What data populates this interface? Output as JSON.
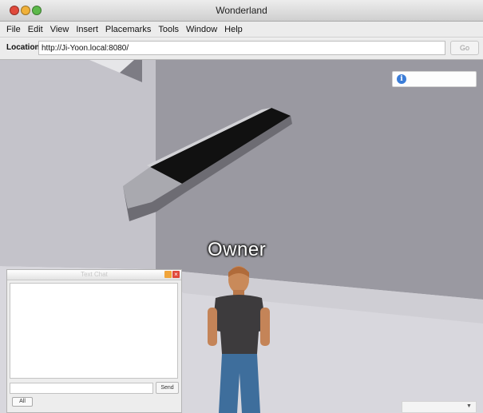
{
  "window": {
    "title": "Wonderland"
  },
  "menu": [
    "File",
    "Edit",
    "View",
    "Insert",
    "Placemarks",
    "Tools",
    "Window",
    "Help"
  ],
  "location": {
    "label": "Location:",
    "url": "http://Ji-Yoon.local:8080/",
    "go_label": "Go"
  },
  "scene": {
    "avatar_name": "Owner",
    "info_icon": "info-icon"
  },
  "chat": {
    "title": "Text Chat",
    "send_label": "Send",
    "tab_label": "All"
  },
  "colors": {
    "sky_wall": "#9c9ba3",
    "floor": "#c9c8cf",
    "accent_info": "#3b7dd8"
  }
}
